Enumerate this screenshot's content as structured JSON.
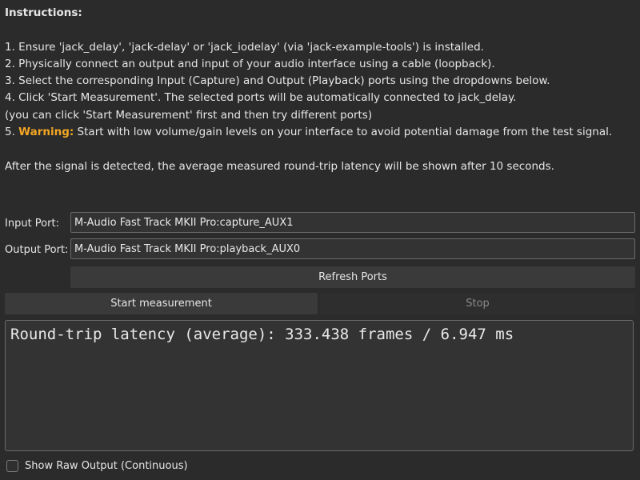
{
  "instructions": {
    "title": "Instructions:",
    "step1": "1. Ensure 'jack_delay', 'jack-delay' or 'jack_iodelay' (via 'jack-example-tools') is installed.",
    "step2": "2. Physically connect an output and input of your audio interface using a cable (loopback).",
    "step3": "3. Select the corresponding Input (Capture) and Output (Playback) ports using the dropdowns below.",
    "step4": "4. Click 'Start Measurement'. The selected ports will be automatically connected to jack_delay.",
    "step4_note": "(you can click 'Start Measurement' first and then try different ports)",
    "step5_prefix": "5. ",
    "step5_warning": "Warning:",
    "step5_text": " Start with low volume/gain levels on your interface to avoid potential damage from the test signal.",
    "note": "After the signal is detected, the average measured round-trip latency will be shown after 10 seconds."
  },
  "input_port": {
    "label": "Input Port:",
    "value": "M-Audio Fast Track MKII Pro:capture_AUX1"
  },
  "output_port": {
    "label": "Output Port:",
    "value": "M-Audio Fast Track MKII Pro:playback_AUX0"
  },
  "buttons": {
    "refresh": "Refresh Ports",
    "start": "Start measurement",
    "stop": "Stop"
  },
  "result": {
    "text": "Round-trip latency (average): 333.438 frames / 6.947 ms"
  },
  "raw_output": {
    "label": "Show Raw Output (Continuous)",
    "checked": false
  },
  "colors": {
    "warning": "#f5a623",
    "background": "#2b2b2b"
  }
}
